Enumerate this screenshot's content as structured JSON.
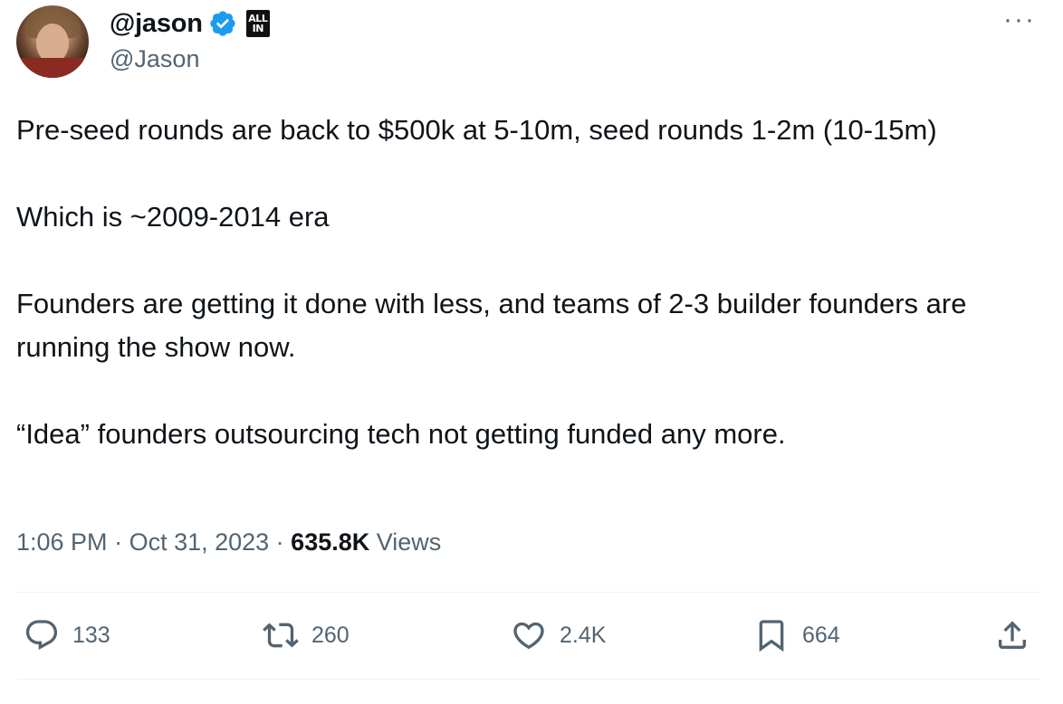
{
  "author": {
    "display_name": "@jason",
    "handle": "@Jason",
    "verified_icon": "verified-badge-icon",
    "affiliation_badge": {
      "line1": "ALL",
      "line2": "IN"
    }
  },
  "tweet": {
    "paragraphs": [
      "Pre-seed rounds are back to $500k at 5-10m, seed rounds 1-2m (10-15m)",
      "Which is ~2009-2014 era",
      "Founders are getting it done with less, and teams of 2-3 builder founders are running the show now.",
      "“Idea” founders outsourcing tech not getting funded any more."
    ],
    "time": "1:06 PM",
    "separator": " · ",
    "date": "Oct 31, 2023",
    "views_count": "635.8K",
    "views_label": " Views"
  },
  "actions": {
    "reply": {
      "icon": "reply-icon",
      "count": "133"
    },
    "retweet": {
      "icon": "retweet-icon",
      "count": "260"
    },
    "like": {
      "icon": "heart-icon",
      "count": "2.4K"
    },
    "bookmark": {
      "icon": "bookmark-icon",
      "count": "664"
    },
    "share": {
      "icon": "share-icon"
    }
  },
  "colors": {
    "text": "#0f1419",
    "secondary": "#536471",
    "verified": "#1d9bf0",
    "divider": "#eff3f4"
  }
}
